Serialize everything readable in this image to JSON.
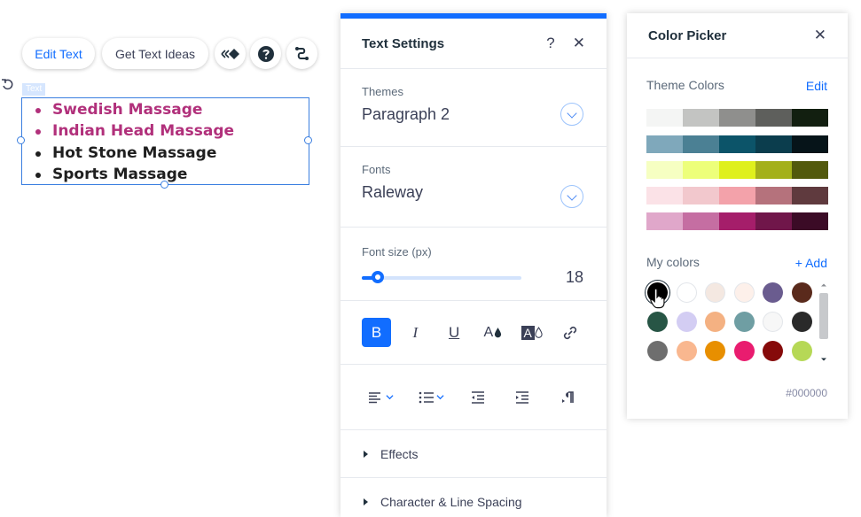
{
  "toolbar": {
    "edit_text": "Edit Text",
    "get_text_ideas": "Get Text Ideas",
    "icons": [
      "animation-icon",
      "help-icon",
      "link-icon"
    ]
  },
  "canvas": {
    "tag_label": "Text",
    "list_items": [
      {
        "text": "Swedish Massage",
        "color": "#b1307b"
      },
      {
        "text": "Indian Head Massage",
        "color": "#b1307b"
      },
      {
        "text": "Hot Stone Massage",
        "color": "#1f1f1f"
      },
      {
        "text": "Sports Massage",
        "color": "#1f1f1f"
      }
    ]
  },
  "text_settings": {
    "title": "Text Settings",
    "help": "?",
    "close": "✕",
    "themes_label": "Themes",
    "themes_value": "Paragraph 2",
    "fonts_label": "Fonts",
    "fonts_value": "Raleway",
    "font_size_label": "Font size (px)",
    "font_size_value": "18",
    "font_size_slider_fraction": 0.1,
    "format_buttons": {
      "bold": "B",
      "italic": "I",
      "underline": "U",
      "text_color_letter": "A",
      "highlight_letter": "A"
    },
    "effects_label": "Effects",
    "char_spacing_label": "Character & Line Spacing"
  },
  "color_picker": {
    "title": "Color Picker",
    "close": "✕",
    "theme_colors_label": "Theme Colors",
    "edit_label": "Edit",
    "theme_rows": [
      [
        "#f4f5f4",
        "#c3c4c2",
        "#8f8f8d",
        "#5e5f5c",
        "#121f10"
      ],
      [
        "#7fa8bb",
        "#4b8094",
        "#0c5469",
        "#0b3d4d",
        "#061419"
      ],
      [
        "#f6ffc2",
        "#edff7a",
        "#dff01d",
        "#a4b01a",
        "#52590c"
      ],
      [
        "#fbe2e7",
        "#f2c8cd",
        "#f3a2aa",
        "#b5727c",
        "#5f3a3e"
      ],
      [
        "#e0a7ca",
        "#c56ea2",
        "#a51e6a",
        "#70164a",
        "#3b0b26"
      ]
    ],
    "my_colors_label": "My colors",
    "add_label": "+ Add",
    "my_colors": [
      "#000000",
      "#ffffff",
      "#f4e8e1",
      "#fdf0ea",
      "#6a5c8f",
      "#5a2a1c",
      "#275545",
      "#d3cdf3",
      "#f4b182",
      "#6f9ea3",
      "#f7f7f7",
      "#2a2a2a",
      "#6e6e6e",
      "#f9b78f",
      "#e88f00",
      "#e91c6f",
      "#860a0a",
      "#b6d856"
    ],
    "hex_value": "#000000"
  }
}
